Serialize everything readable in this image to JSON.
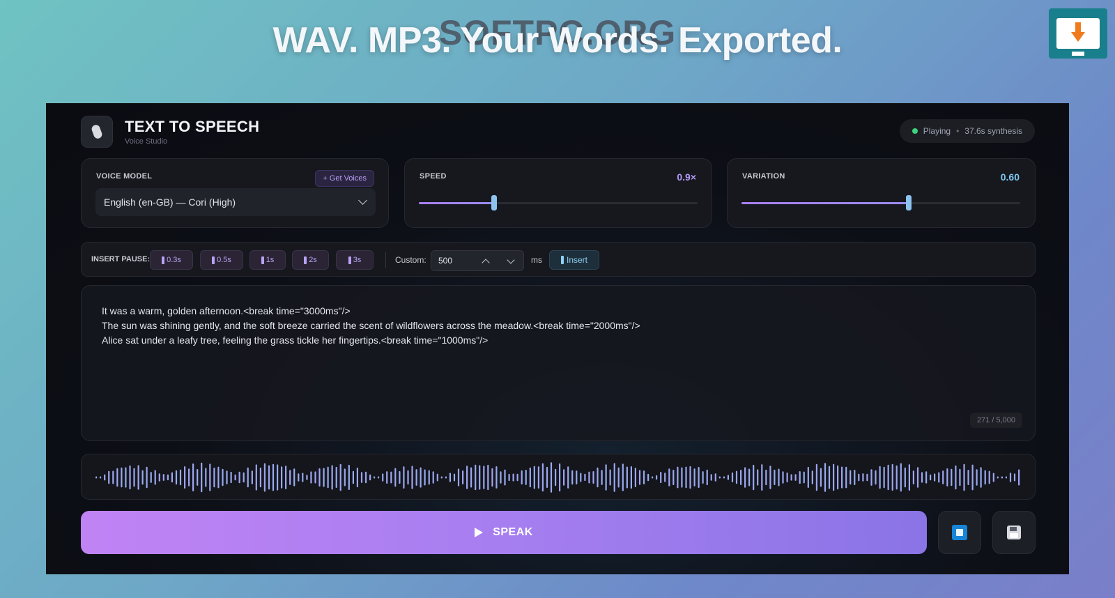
{
  "banner": {
    "headline": "WAV. MP3. Your Words. Exported.",
    "watermark": "SOFTPC.ORG"
  },
  "app": {
    "title": "TEXT TO SPEECH",
    "subtitle": "Voice Studio",
    "status": {
      "state": "Playing",
      "separator": "•",
      "synthesis": "37.6s synthesis",
      "dot_color": "#3ed27a"
    }
  },
  "voice_model": {
    "label": "VOICE MODEL",
    "get_voices_label": "+ Get Voices",
    "selected": "English (en-GB) — Cori (High)"
  },
  "speed": {
    "label": "SPEED",
    "value_text": "0.9×",
    "fraction": 0.27
  },
  "variation": {
    "label": "VARIATION",
    "value_text": "0.60",
    "fraction": 0.6
  },
  "pause": {
    "label": "INSERT PAUSE:",
    "presets": [
      "0.3s",
      "0.5s",
      "1s",
      "2s",
      "3s"
    ],
    "custom_label": "Custom:",
    "custom_value": "500",
    "unit": "ms",
    "insert_label": "Insert"
  },
  "editor": {
    "lines": [
      "It was a warm, golden afternoon.<break time=\"3000ms\"/>",
      "The sun was shining gently, and the soft breeze carried the scent of wildflowers across the meadow.<break time=\"2000ms\"/>",
      "Alice sat under a leafy tree, feeling the grass tickle her fingertips.<break time=\"1000ms\"/>"
    ],
    "counter": "271 / 5,000"
  },
  "actions": {
    "speak_label": "SPEAK",
    "stop_icon": "stop-icon",
    "save_icon": "save-icon"
  },
  "colors": {
    "accent_purple": "#b49af4",
    "accent_blue": "#7ec6f1",
    "stop_blue": "#1784d8"
  }
}
